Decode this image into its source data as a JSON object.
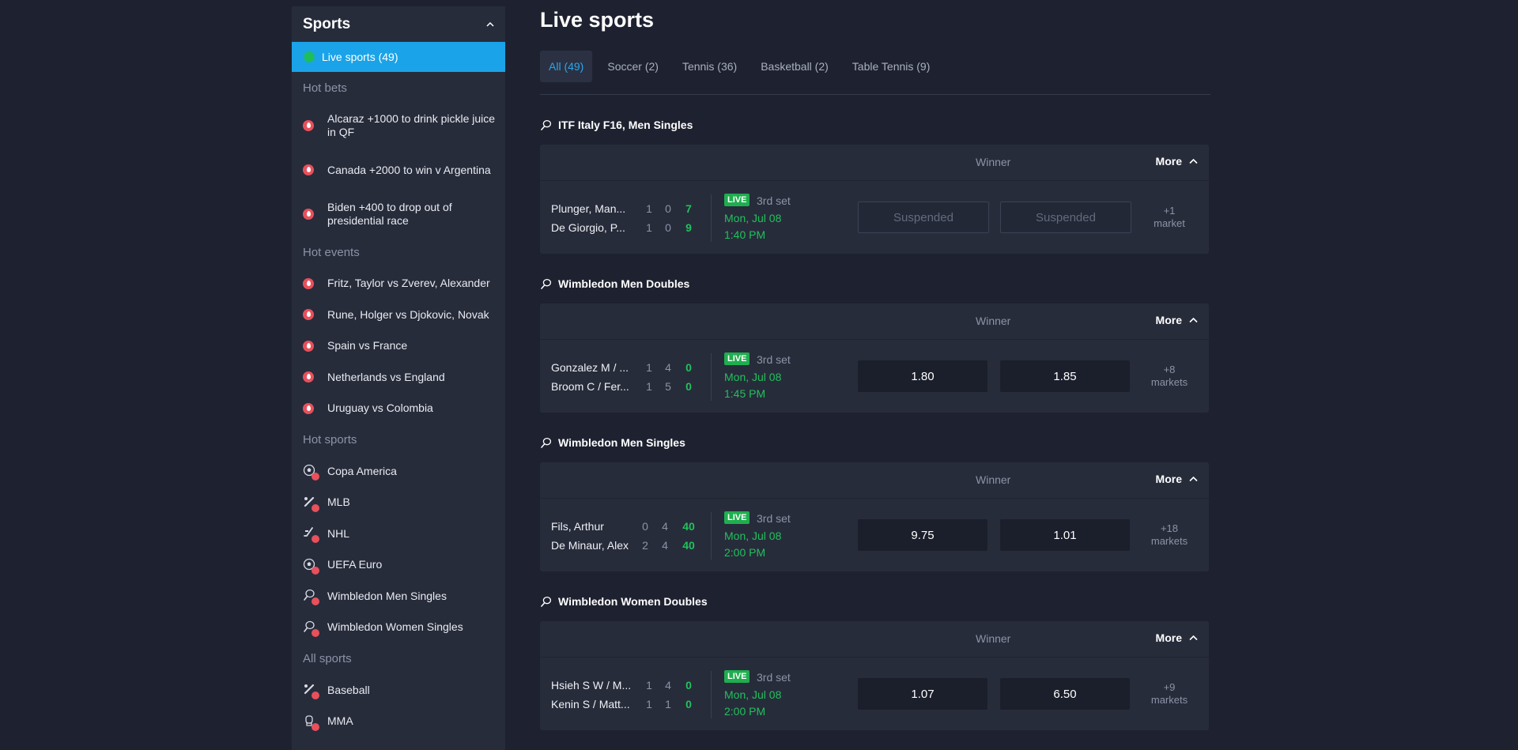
{
  "sidebar": {
    "title": "Sports",
    "live": "Live sports (49)",
    "hot_bets_label": "Hot bets",
    "hot_bets": [
      "Alcaraz +1000 to drink pickle juice in QF",
      "Canada +2000 to win v Argentina",
      "Biden +400 to drop out of presidential race"
    ],
    "hot_events_label": "Hot events",
    "hot_events": [
      "Fritz, Taylor vs Zverev, Alexander",
      "Rune, Holger vs Djokovic, Novak",
      "Spain vs France",
      "Netherlands vs England",
      "Uruguay vs Colombia"
    ],
    "hot_sports_label": "Hot sports",
    "hot_sports": [
      {
        "label": "Copa America",
        "icon": "soccer-ball-icon"
      },
      {
        "label": "MLB",
        "icon": "baseball-bat-icon"
      },
      {
        "label": "NHL",
        "icon": "hockey-stick-icon"
      },
      {
        "label": "UEFA Euro",
        "icon": "soccer-ball-icon"
      },
      {
        "label": "Wimbledon Men Singles",
        "icon": "tennis-racket-icon"
      },
      {
        "label": "Wimbledon Women Singles",
        "icon": "tennis-racket-icon"
      }
    ],
    "all_sports_label": "All sports",
    "all_sports": [
      {
        "label": "Baseball",
        "icon": "baseball-bat-icon"
      },
      {
        "label": "MMA",
        "icon": "glove-icon"
      }
    ]
  },
  "main": {
    "title": "Live sports",
    "tabs": [
      "All (49)",
      "Soccer (2)",
      "Tennis (36)",
      "Basketball (2)",
      "Table Tennis (9)"
    ],
    "winner_label": "Winner",
    "more_label": "More",
    "live_label": "LIVE",
    "leagues": [
      {
        "name": "ITF Italy F16, Men Singles",
        "team1": "Plunger, Man...",
        "s1": [
          "1",
          "0",
          "7"
        ],
        "team2": "De Giorgio, P...",
        "s2": [
          "1",
          "0",
          "9"
        ],
        "set": "3rd set",
        "date": "Mon, Jul 08",
        "time": "1:40 PM",
        "odd1": "Suspended",
        "odd2": "Suspended",
        "markets1": "+1",
        "markets2": "market"
      },
      {
        "name": "Wimbledon Men Doubles",
        "team1": "Gonzalez M / ...",
        "s1": [
          "1",
          "4",
          "0"
        ],
        "team2": "Broom C / Fer...",
        "s2": [
          "1",
          "5",
          "0"
        ],
        "set": "3rd set",
        "date": "Mon, Jul 08",
        "time": "1:45 PM",
        "odd1": "1.80",
        "odd2": "1.85",
        "markets1": "+8",
        "markets2": "markets"
      },
      {
        "name": "Wimbledon Men Singles",
        "team1": "Fils, Arthur",
        "s1": [
          "0",
          "4",
          "40"
        ],
        "team2": "De Minaur, Alex",
        "s2": [
          "2",
          "4",
          "40"
        ],
        "set": "3rd set",
        "date": "Mon, Jul 08",
        "time": "2:00 PM",
        "odd1": "9.75",
        "odd2": "1.01",
        "markets1": "+18",
        "markets2": "markets"
      },
      {
        "name": "Wimbledon Women Doubles",
        "team1": "Hsieh S W / M...",
        "s1": [
          "1",
          "4",
          "0"
        ],
        "team2": "Kenin S / Matt...",
        "s2": [
          "1",
          "1",
          "0"
        ],
        "set": "3rd set",
        "date": "Mon, Jul 08",
        "time": "2:00 PM",
        "odd1": "1.07",
        "odd2": "6.50",
        "markets1": "+9",
        "markets2": "markets"
      }
    ]
  },
  "colors": {
    "accent": "#1aa3e8",
    "live_green": "#1fae4f",
    "score_green": "#21c15a",
    "hot": "#e8505b"
  }
}
